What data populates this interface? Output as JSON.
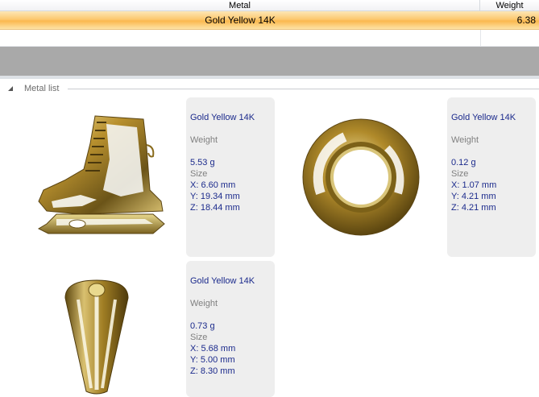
{
  "table": {
    "headers": {
      "metal": "Metal",
      "weight": "Weight"
    },
    "rows": [
      {
        "metal": "Gold Yellow 14K",
        "weight": "6.38"
      }
    ]
  },
  "group": {
    "label": "Metal list"
  },
  "cards": [
    {
      "metal": "Gold Yellow 14K",
      "weight_label": "Weight",
      "weight": "5.53 g",
      "size_label": "Size",
      "x": "X: 6.60 mm",
      "y": "Y: 19.34 mm",
      "z": "Z: 18.44 mm",
      "icon": "ice-skate-model"
    },
    {
      "metal": "Gold Yellow 14K",
      "weight_label": "Weight",
      "weight": "0.12 g",
      "size_label": "Size",
      "x": "X: 1.07 mm",
      "y": "Y: 4.21 mm",
      "z": "Z: 4.21 mm",
      "icon": "ring-model"
    },
    {
      "metal": "Gold Yellow 14K",
      "weight_label": "Weight",
      "weight": "0.73 g",
      "size_label": "Size",
      "x": "X: 5.68 mm",
      "y": "Y: 5.00 mm",
      "z": "Z: 8.30 mm",
      "icon": "bail-cap-model"
    }
  ],
  "colors": {
    "selected_row": "#fcc86f",
    "metal_text": "#1b2a8c",
    "band": "#a9a9a9"
  }
}
